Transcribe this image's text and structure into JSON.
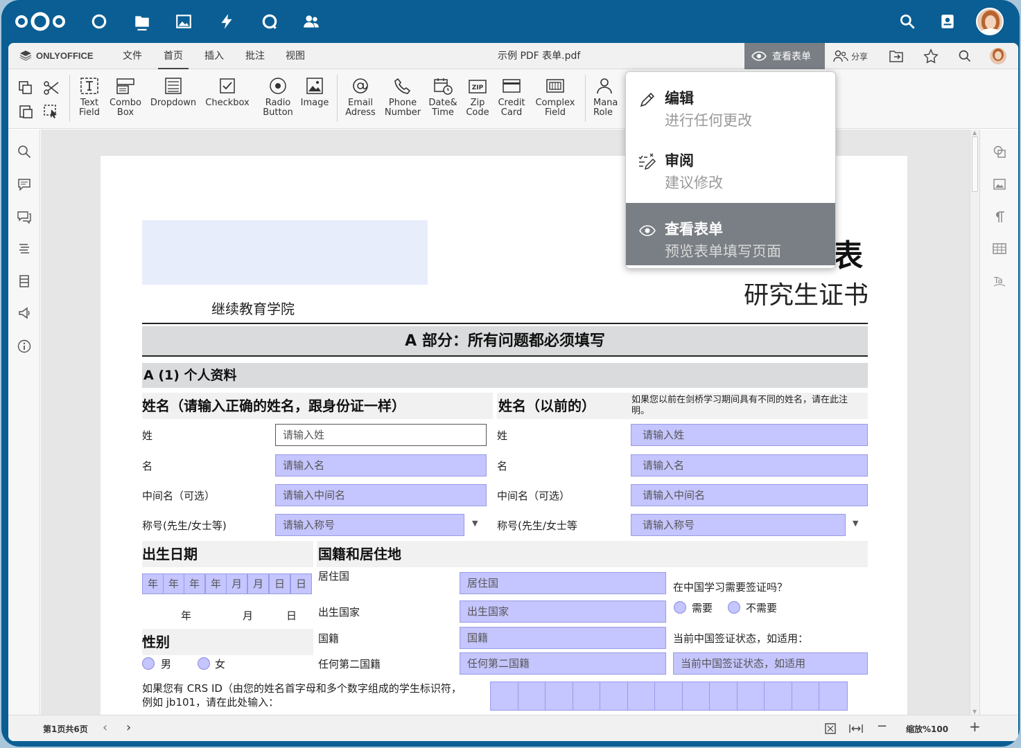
{
  "topbar": {
    "apps": [
      {
        "name": "dashboard-icon"
      },
      {
        "name": "files-icon"
      },
      {
        "name": "photos-icon"
      },
      {
        "name": "activity-icon"
      },
      {
        "name": "search-app-icon"
      },
      {
        "name": "contacts-icon"
      }
    ],
    "right_icons": [
      "search-icon",
      "contacts-menu-icon",
      "avatar"
    ]
  },
  "editor": {
    "brand": "ONLYOFFICE",
    "menu": [
      "文件",
      "首页",
      "插入",
      "批注",
      "视图"
    ],
    "active_menu": "首页",
    "document_title": "示例 PDF 表单.pdf",
    "view_mode_label": "查看表单",
    "share_label": "分享"
  },
  "toolbar": {
    "buttons": [
      {
        "label1": "Text",
        "label2": "Field"
      },
      {
        "label1": "Combo",
        "label2": "Box"
      },
      {
        "label1": "Dropdown",
        "label2": ""
      },
      {
        "label1": "Checkbox",
        "label2": ""
      },
      {
        "label1": "Radio",
        "label2": "Button"
      },
      {
        "label1": "Image",
        "label2": ""
      },
      {
        "label1": "Email",
        "label2": "Adress"
      },
      {
        "label1": "Phone",
        "label2": "Number"
      },
      {
        "label1": "Date&",
        "label2": "Time"
      },
      {
        "label1": "Zip",
        "label2": "Code"
      },
      {
        "label1": "Credit",
        "label2": "Card"
      },
      {
        "label1": "Complex",
        "label2": "Field"
      },
      {
        "label1": "Mana",
        "label2": "Role"
      }
    ]
  },
  "mode_menu": {
    "items": [
      {
        "title": "编辑",
        "desc": "进行任何更改",
        "icon": "pencil-icon"
      },
      {
        "title": "审阅",
        "desc": "建议修改",
        "icon": "review-icon"
      },
      {
        "title": "查看表单",
        "desc": "预览表单填写页面",
        "icon": "eye-icon"
      }
    ],
    "selected": "查看表单"
  },
  "document": {
    "institute": "继续教育学院",
    "title_fragment": "表",
    "subtitle": "研究生证书",
    "part_a": "A 部分：所有问题都必须填写",
    "section_a1": "A (1) 个人资料",
    "name_heading": "姓名（请输入正确的姓名，跟身份证一样）",
    "prev_name_heading": "姓名（以前的）",
    "prev_name_note": "如果您以前在剑桥学习期间具有不同的姓名，请在此注明。",
    "left_rows": [
      {
        "label": "姓",
        "placeholder": "请输入姓"
      },
      {
        "label": "名",
        "placeholder": "请输入名"
      },
      {
        "label": "中间名（可选）",
        "placeholder": "请输入中间名"
      },
      {
        "label": "称号(先生/女士等)",
        "placeholder": "请输入称号"
      }
    ],
    "right_rows": [
      {
        "label": "姓",
        "placeholder": "请输入姓"
      },
      {
        "label": "名",
        "placeholder": "请输入名"
      },
      {
        "label": "中间名（可选）",
        "placeholder": "请输入中间名"
      },
      {
        "label": "称号(先生/女士等",
        "placeholder": "请输入称号"
      }
    ],
    "dob_heading": "出生日期",
    "dob_cells": [
      "年",
      "年",
      "年",
      "年",
      "月",
      "月",
      "日",
      "日"
    ],
    "dob_labels": [
      "年",
      "月",
      "日"
    ],
    "nationality_heading": "国籍和居住地",
    "nat_rows": [
      {
        "label": "居住国",
        "placeholder": "居住国"
      },
      {
        "label": "出生国家",
        "placeholder": "出生国家"
      },
      {
        "label": "国籍",
        "placeholder": "国籍"
      },
      {
        "label": "任何第二国籍",
        "placeholder": "任何第二国籍"
      }
    ],
    "visa_question": "在中国学习需要签证吗？",
    "visa_options": [
      "需要",
      "不需要"
    ],
    "visa_status_label": "当前中国签证状态，如适用：",
    "visa_status_placeholder": "当前中国签证状态，如适用",
    "gender_heading": "性别",
    "gender_options": [
      "男",
      "女"
    ],
    "crs_text_1": "如果您有 CRS ID（由您的姓名首字母和多个数字组成的学生标识符，",
    "crs_text_2": "例如 jb101，请在此处输入："
  },
  "statusbar": {
    "page_info": "第1页共6页",
    "zoom": "缩放%100"
  },
  "colors": {
    "nextcloud_blue": "#0a5e93",
    "field_fill": "#c5c5ff",
    "active_mode": "#7a7f85"
  }
}
